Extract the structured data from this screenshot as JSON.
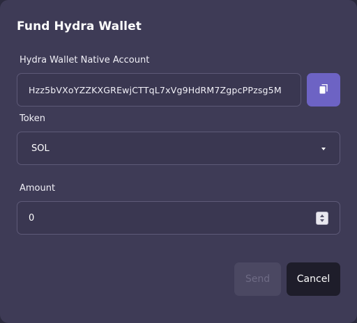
{
  "modal": {
    "title": "Fund Hydra Wallet"
  },
  "account": {
    "label": "Hydra Wallet Native Account",
    "value": "Hzz5bVXoYZZKXGREwjCTTqL7xVg9HdRM7ZgpcPPzsg5M",
    "copy_icon": "copy-icon"
  },
  "token": {
    "label": "Token",
    "selected": "SOL",
    "dropdown_icon": "caret-down-icon"
  },
  "amount": {
    "label": "Amount",
    "value": "0"
  },
  "actions": {
    "send_label": "Send",
    "cancel_label": "Cancel"
  },
  "colors": {
    "modal_bg": "#3e3b56",
    "accent": "#6d63c4",
    "cancel_bg": "#1e1d2a",
    "send_disabled_bg": "#4b4862"
  }
}
